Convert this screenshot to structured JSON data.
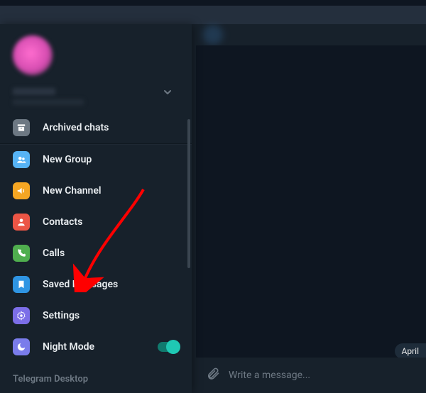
{
  "app": {
    "name": "Telegram Desktop"
  },
  "sidebar": {
    "archived_label": "Archived chats",
    "items": [
      {
        "label": "New Group"
      },
      {
        "label": "New Channel"
      },
      {
        "label": "Contacts"
      },
      {
        "label": "Calls"
      },
      {
        "label": "Saved Messages"
      },
      {
        "label": "Settings"
      },
      {
        "label": "Night Mode"
      }
    ],
    "night_mode_on": true
  },
  "chat": {
    "date_badge": "April",
    "input_placeholder": "Write a message..."
  },
  "icons": {
    "archive": "archive-icon",
    "group": "group-icon",
    "channel": "channel-icon",
    "contacts": "contacts-icon",
    "calls": "calls-icon",
    "saved": "saved-icon",
    "settings": "settings-icon",
    "night": "night-icon",
    "chevron": "chevron-down-icon",
    "attach": "attach-icon"
  }
}
